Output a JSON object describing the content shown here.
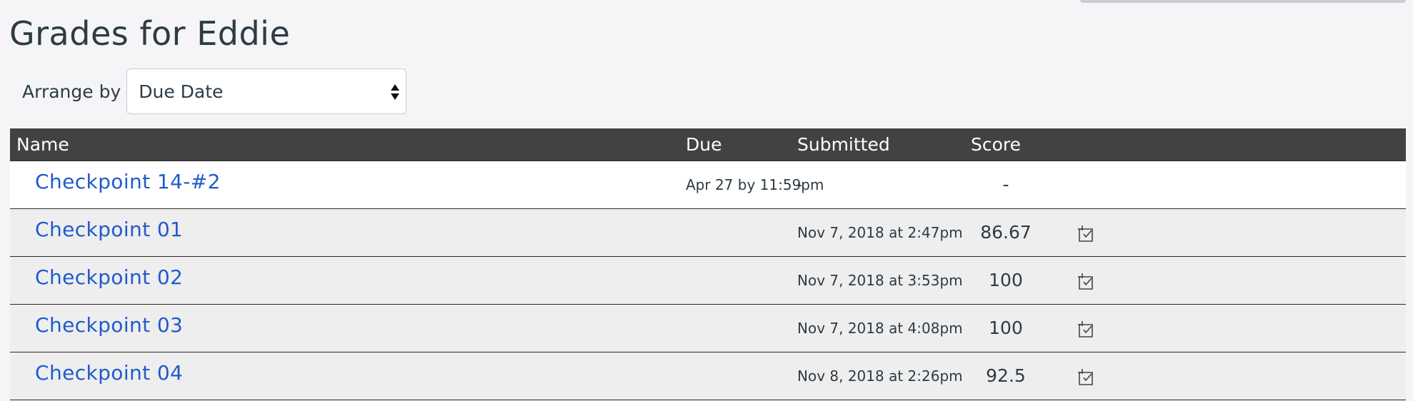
{
  "page": {
    "title": "Grades for Eddie",
    "arrange_label": "Arrange by",
    "arrange_value": "Due Date"
  },
  "table": {
    "headers": {
      "name": "Name",
      "due": "Due",
      "submitted": "Submitted",
      "score": "Score"
    },
    "rows": [
      {
        "name": "Checkpoint 14-#2",
        "due": "Apr 27 by 11:59pm",
        "submitted": "-",
        "score": "-",
        "icon": ""
      },
      {
        "name": "Checkpoint 01",
        "due": "",
        "submitted": "Nov 7, 2018 at 2:47pm",
        "score": "86.67",
        "icon": "submission-details-icon"
      },
      {
        "name": "Checkpoint 02",
        "due": "",
        "submitted": "Nov 7, 2018 at 3:53pm",
        "score": "100",
        "icon": "submission-details-icon"
      },
      {
        "name": "Checkpoint 03",
        "due": "",
        "submitted": "Nov 7, 2018 at 4:08pm",
        "score": "100",
        "icon": "submission-details-icon"
      },
      {
        "name": "Checkpoint 04",
        "due": "",
        "submitted": "Nov 8, 2018 at 2:26pm",
        "score": "92.5",
        "icon": "submission-details-icon"
      }
    ]
  },
  "colors": {
    "link": "#1f5bcc",
    "header_bg": "#424242",
    "row_alt_bg": "#eeeeee"
  }
}
